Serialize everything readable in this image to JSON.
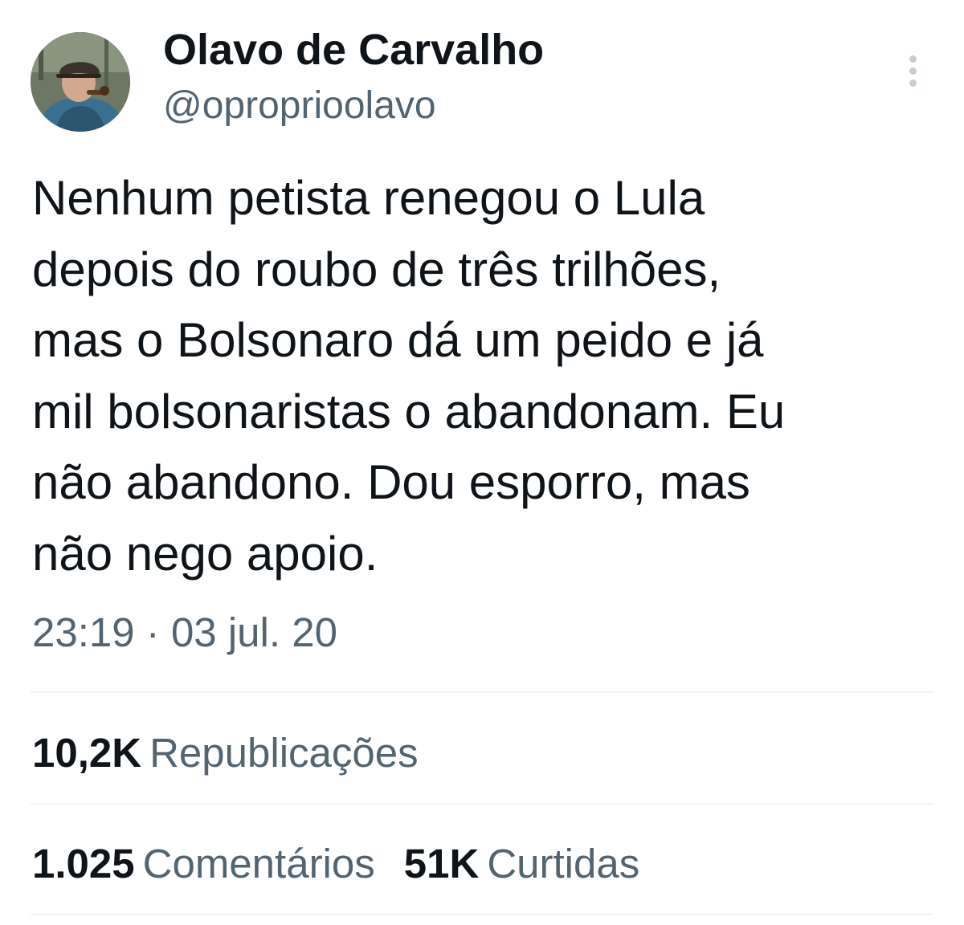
{
  "author": {
    "display_name": "Olavo de Carvalho",
    "handle": "@oproprioolavo",
    "avatar_icon": "profile-photo"
  },
  "tweet": {
    "text_lines": [
      "Nenhum petista renegou o Lula",
      "depois do roubo de três trilhões,",
      "mas o Bolsonaro dá um peido e já",
      "mil bolsonaristas o abandonam. Eu",
      "não abandono. Dou esporro, mas",
      "não nego apoio."
    ],
    "timestamp": "23:19 · 03 jul. 20"
  },
  "stats": {
    "reposts": {
      "count": "10,2K",
      "label": "Republicações"
    },
    "comments": {
      "count": "1.025",
      "label": "Comentários"
    },
    "likes": {
      "count": "51K",
      "label": "Curtidas"
    }
  },
  "icons": {
    "more": "more-vertical-icon"
  },
  "colors": {
    "text_primary": "#0f1419",
    "text_secondary": "#536471",
    "divider": "#eff3f4",
    "more_dots": "#c4cfd6"
  }
}
